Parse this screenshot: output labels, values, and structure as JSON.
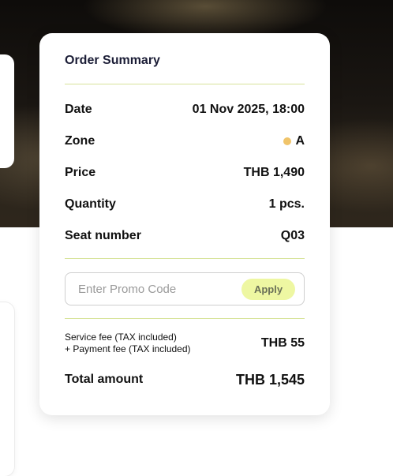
{
  "order_summary": {
    "title": "Order Summary",
    "rows": [
      {
        "label": "Date",
        "value": "01 Nov 2025, 18:00"
      },
      {
        "label": "Zone",
        "value": "A"
      },
      {
        "label": "Price",
        "value": "THB 1,490"
      },
      {
        "label": "Quantity",
        "value": "1 pcs."
      },
      {
        "label": "Seat number",
        "value": "Q03"
      }
    ],
    "zone_color": "#f0c46a",
    "promo": {
      "placeholder": "Enter Promo Code",
      "value": "",
      "apply_label": "Apply"
    },
    "fees": {
      "service_fee_label": "Service fee (TAX included)",
      "payment_fee_label": "+ Payment fee (TAX included)",
      "value": "THB 55"
    },
    "total": {
      "label": "Total amount",
      "value": "THB 1,545"
    }
  },
  "colors": {
    "accent_divider": "#d7e39a",
    "apply_button_bg": "#eef7a2",
    "title_text": "#1b1d36"
  }
}
